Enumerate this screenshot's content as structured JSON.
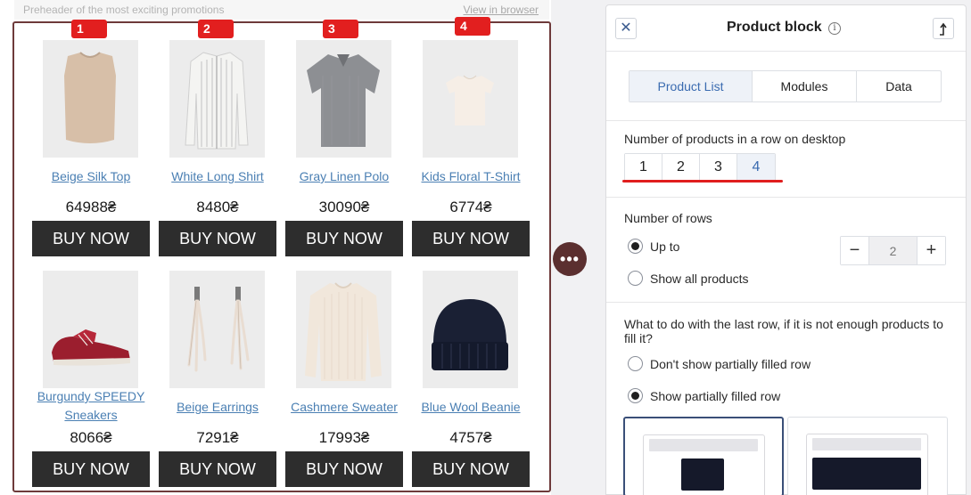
{
  "preview": {
    "preheader": "Preheader of the most exciting promotions",
    "view_in_browser": "View in browser",
    "column_badges": [
      "1",
      "2",
      "3",
      "4"
    ],
    "buy_label": "BUY NOW",
    "products": [
      {
        "name": "Beige Silk Top",
        "price": "64988₴",
        "image": "beige-top-image"
      },
      {
        "name": "White Long Shirt",
        "price": "8480₴",
        "image": "white-shirt-image"
      },
      {
        "name": "Gray Linen Polo",
        "price": "30090₴",
        "image": "gray-polo-image"
      },
      {
        "name": "Kids Floral T-Shirt",
        "price": "6774₴",
        "image": "kids-tshirt-image"
      },
      {
        "name": "Burgundy SPEEDY Sneakers",
        "price": "8066₴",
        "image": "sneakers-image"
      },
      {
        "name": "Beige Earrings",
        "price": "7291₴",
        "image": "earrings-image"
      },
      {
        "name": "Cashmere Sweater",
        "price": "17993₴",
        "image": "sweater-image"
      },
      {
        "name": "Blue Wool Beanie",
        "price": "4757₴",
        "image": "beanie-image"
      }
    ],
    "more_icon": "ellipsis-icon"
  },
  "panel": {
    "title": "Product block",
    "close_icon": "close-icon",
    "info_icon": "info-icon",
    "collapse_icon": "arrow-up-icon",
    "tabs": [
      {
        "label": "Product List",
        "active": true
      },
      {
        "label": "Modules",
        "active": false
      },
      {
        "label": "Data",
        "active": false
      }
    ],
    "per_row": {
      "label": "Number of products in a row on desktop",
      "options": [
        "1",
        "2",
        "3",
        "4"
      ],
      "selected": "4"
    },
    "rows": {
      "label": "Number of rows",
      "up_to_label": "Up to",
      "show_all_label": "Show all products",
      "selected": "up_to",
      "value": "2",
      "minus": "−",
      "plus": "+"
    },
    "last_row": {
      "label": "What to do with the last row, if it is not enough products to fill it?",
      "option_hide": "Don't show partially filled row",
      "option_show": "Show partially filled row",
      "selected": "show"
    }
  },
  "colors": {
    "accent": "#3a6bb0",
    "buy_button": "#2d2d2d",
    "badge": "#e21f1f",
    "block_border": "#6e3a3a"
  }
}
